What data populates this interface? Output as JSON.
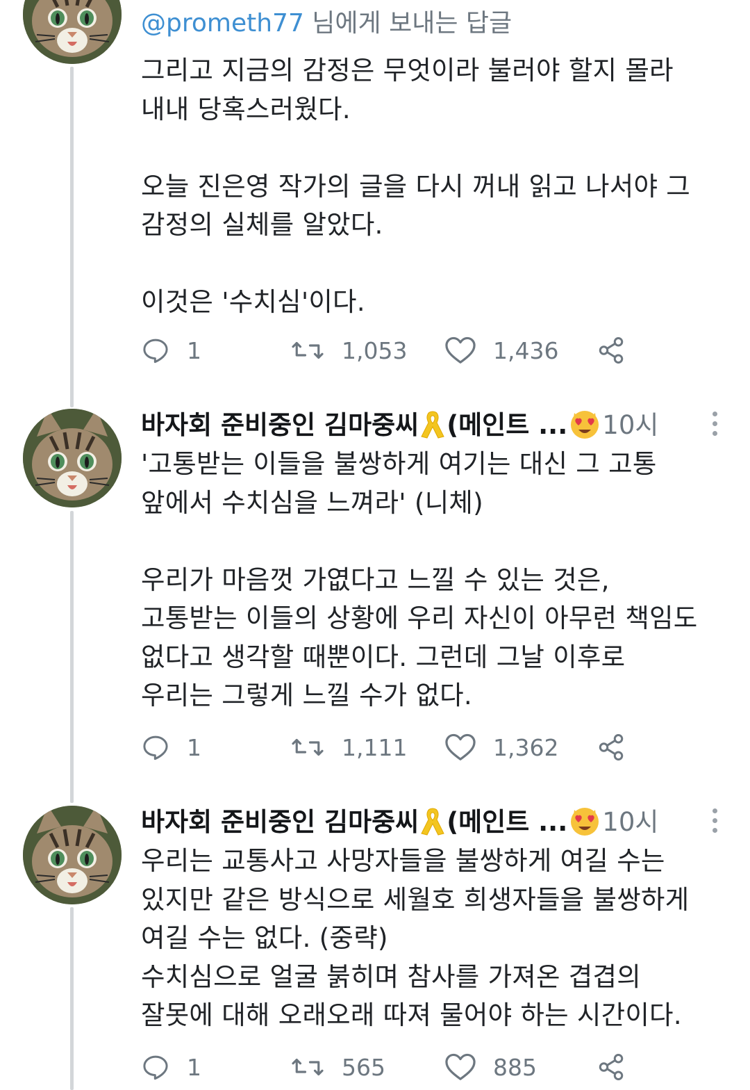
{
  "tweets": [
    {
      "reply_prefix": "@prometh77",
      "reply_suffix": " 님에게 보내는 답글",
      "body": "그리고 지금의 감정은 무엇이라 불러야 할지 몰라\n내내 당혹스러웠다.\n\n오늘 진은영 작가의 글을 다시 꺼내 읽고 나서야 그\n감정의 실체를 알았다.\n\n이것은 '수치심'이다.",
      "replies": "1",
      "retweets": "1,053",
      "likes": "1,436"
    },
    {
      "author": "바자회 준비중인 김마중씨",
      "author_suffix": "(메인트 ...",
      "time": "10시",
      "body": "'고통받는 이들을 불쌍하게 여기는 대신 그 고통\n앞에서 수치심을 느껴라' (니체)\n\n우리가 마음껏 가엾다고 느낄 수 있는 것은,\n고통받는 이들의 상황에 우리 자신이 아무런 책임도\n없다고 생각할 때뿐이다. 그런데 그날 이후로\n우리는 그렇게 느낄 수가 없다.",
      "replies": "1",
      "retweets": "1,111",
      "likes": "1,362"
    },
    {
      "author": "바자회 준비중인 김마중씨",
      "author_suffix": "(메인트 ...",
      "time": "10시",
      "body": "우리는 교통사고 사망자들을 불쌍하게 여길 수는\n있지만 같은 방식으로 세월호 희생자들을 불쌍하게\n여길 수는 없다. (중략)\n수치심으로 얼굴 붉히며 참사를 가져온 겹겹의\n잘못에 대해 오래오래 따져 물어야 하는 시간이다.",
      "replies": "1",
      "retweets": "565",
      "likes": "885"
    }
  ],
  "icons": {
    "reply": "speech-bubble-icon",
    "retweet": "retweet-icon",
    "like": "heart-icon",
    "share": "share-icon",
    "ribbon": "yellow-ribbon-emoji",
    "heart_eyes": "heart-eyes-emoji",
    "more": "vertical-dots-icon"
  },
  "colors": {
    "handle": "#3e8fd2",
    "secondary": "#6d7780",
    "thread_line": "#d3d6d9",
    "ribbon": "#f3c520",
    "heart_eyes_face": "#f7c23a",
    "heart": "#e23a4a"
  }
}
